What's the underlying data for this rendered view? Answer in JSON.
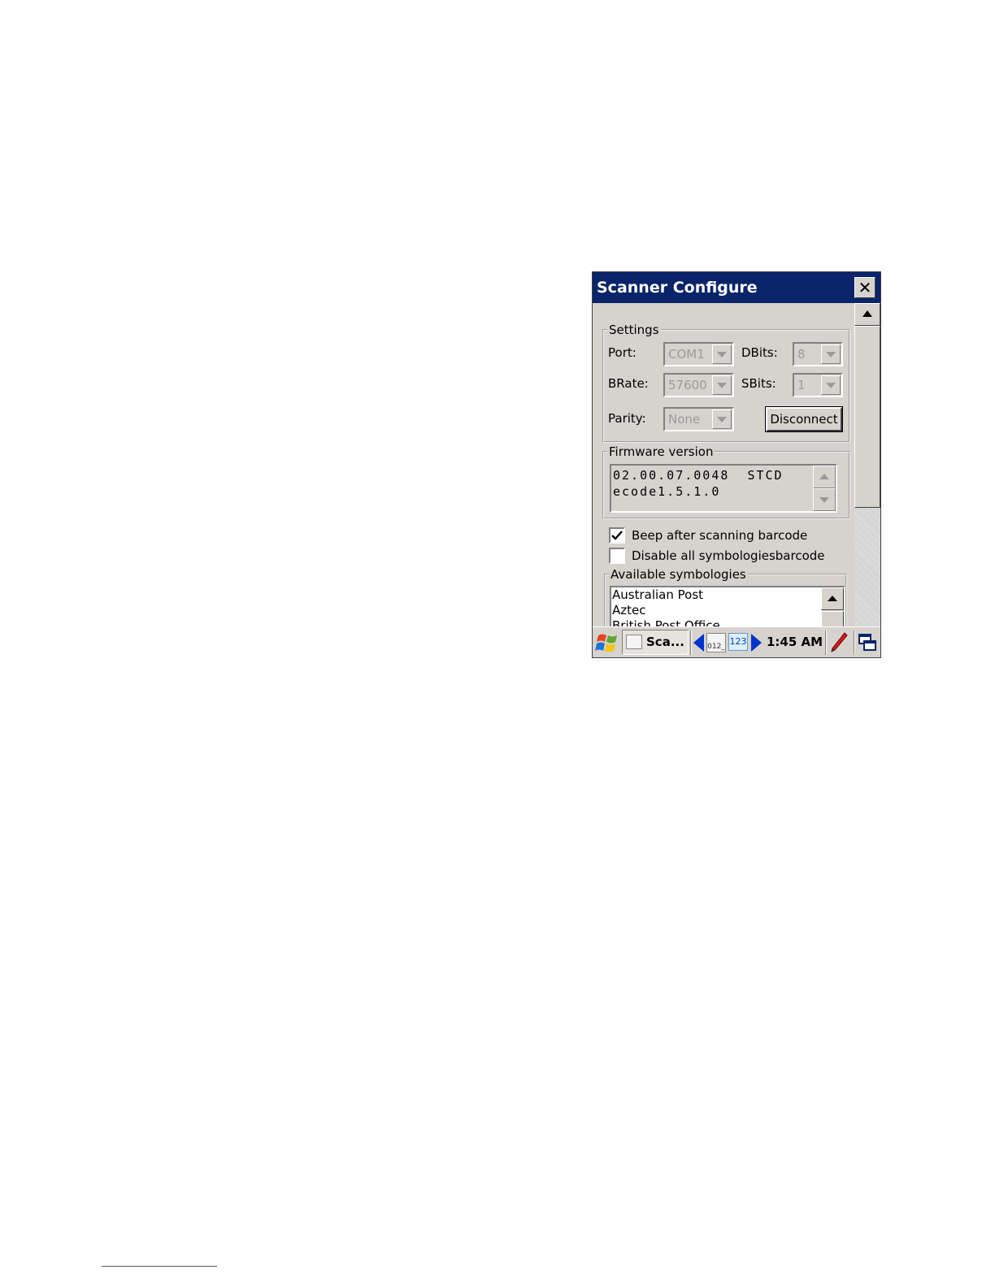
{
  "window": {
    "title": "Scanner Configure",
    "close_label": "✕"
  },
  "settings": {
    "legend": "Settings",
    "port_label": "Port:",
    "port_value": "COM1",
    "dbits_label": "DBits:",
    "dbits_value": "8",
    "brate_label": "BRate:",
    "brate_value": "57600",
    "sbits_label": "SBits:",
    "sbits_value": "1",
    "parity_label": "Parity:",
    "parity_value": "None",
    "disconnect_label": "Disconnect"
  },
  "firmware": {
    "legend": "Firmware version",
    "text": "02.00.07.0048  STCD\necode1.5.1.0"
  },
  "options": {
    "beep_label": "Beep after scanning barcode",
    "beep_checked": true,
    "disable_label": "Disable all symbologiesbarcode",
    "disable_checked": false
  },
  "symbologies": {
    "legend": "Available symbologies",
    "items": [
      "Australian Post",
      "Aztec",
      "British Post Office"
    ]
  },
  "taskbar": {
    "task_label": "Sca...",
    "ime_1_label": "012_",
    "ime_2_label": "123",
    "clock": "1:45 AM"
  },
  "icons": {
    "start": "windows-flag-icon",
    "pen": "pen-icon",
    "windows": "windows-switch-icon"
  }
}
